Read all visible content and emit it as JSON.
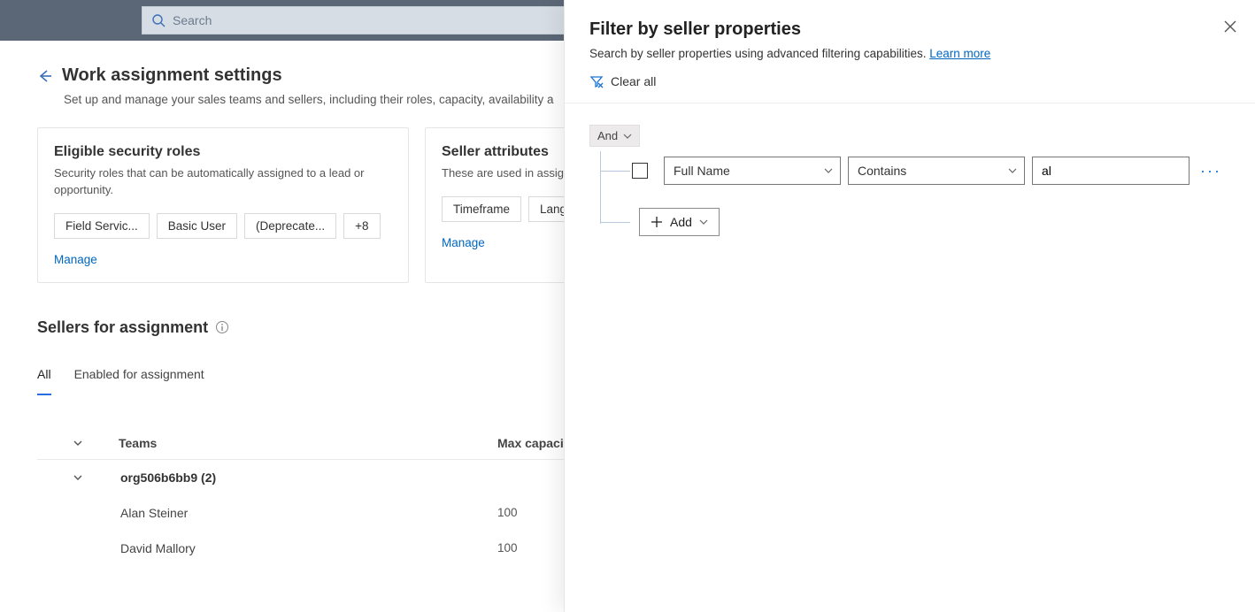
{
  "search": {
    "placeholder": "Search"
  },
  "page": {
    "title": "Work assignment settings",
    "subtitle": "Set up and manage your sales teams and sellers, including their roles, capacity, availability a"
  },
  "cards": {
    "roles": {
      "title": "Eligible security roles",
      "desc": "Security roles that can be automatically assigned to a lead or opportunity.",
      "chips": [
        "Field Servic...",
        "Basic User",
        "(Deprecate...",
        "+8"
      ],
      "manage": "Manage"
    },
    "attrs": {
      "title": "Seller attributes",
      "desc": "These are used in assign",
      "chips": [
        "Timeframe",
        "Langua"
      ],
      "manage": "Manage"
    }
  },
  "sellers": {
    "title": "Sellers for assignment",
    "tabs": {
      "all": "All",
      "enabled": "Enabled for assignment"
    },
    "columns": {
      "teams": "Teams",
      "cap": "Max capacity"
    },
    "group": "org506b6bb9 (2)",
    "rows": [
      {
        "name": "Alan Steiner",
        "cap": "100"
      },
      {
        "name": "David Mallory",
        "cap": "100"
      }
    ]
  },
  "filter": {
    "title": "Filter by seller properties",
    "subtitle": "Search by seller properties using advanced filtering capabilities.  ",
    "learn": "Learn more",
    "clear": "Clear all",
    "logic": "And",
    "field": "Full Name",
    "op": "Contains",
    "value": "al",
    "add": "Add"
  }
}
